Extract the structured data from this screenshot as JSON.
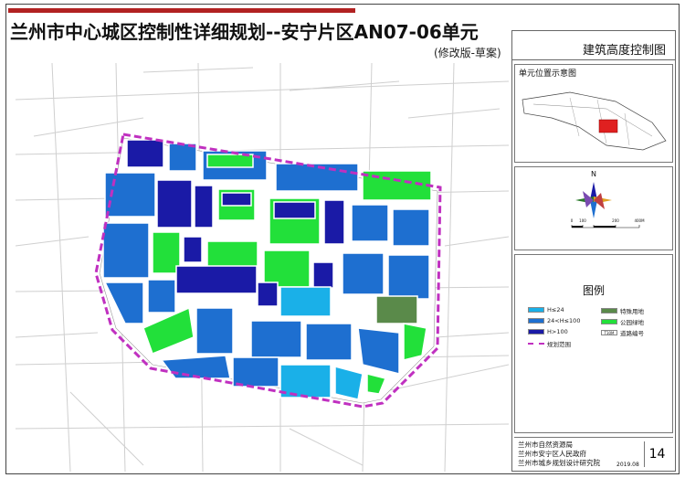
{
  "header": {
    "title": "兰州市中心城区控制性详细规划--安宁片区AN07-06单元",
    "subtitle": "(修改版-草案)",
    "sheet_title": "建筑高度控制图"
  },
  "location_map": {
    "label": "单元位置示意图"
  },
  "compass": {
    "north": "N",
    "scale_ticks": [
      "0",
      "100",
      "200",
      "400M"
    ]
  },
  "legend": {
    "title": "图例",
    "items": [
      {
        "label": "H≤24",
        "color": "#1ab0e8"
      },
      {
        "label": "24<H≤100",
        "color": "#1e6fd0"
      },
      {
        "label": "H>100",
        "color": "#1a1aa6"
      },
      {
        "label": "规划范围",
        "color": "#c030c0"
      },
      {
        "label": "特殊用地",
        "color": "#5a8a4a"
      },
      {
        "label": "公园绿地",
        "color": "#22e03a"
      },
      {
        "label": "道路编号",
        "color": "#444444"
      }
    ],
    "road_tag": "T30M"
  },
  "footer": {
    "lines": [
      "兰州市自然资源局",
      "兰州市安宁区人民政府",
      "兰州市城乡规划设计研究院"
    ],
    "date": "2019.08",
    "sheet_no": "14"
  }
}
